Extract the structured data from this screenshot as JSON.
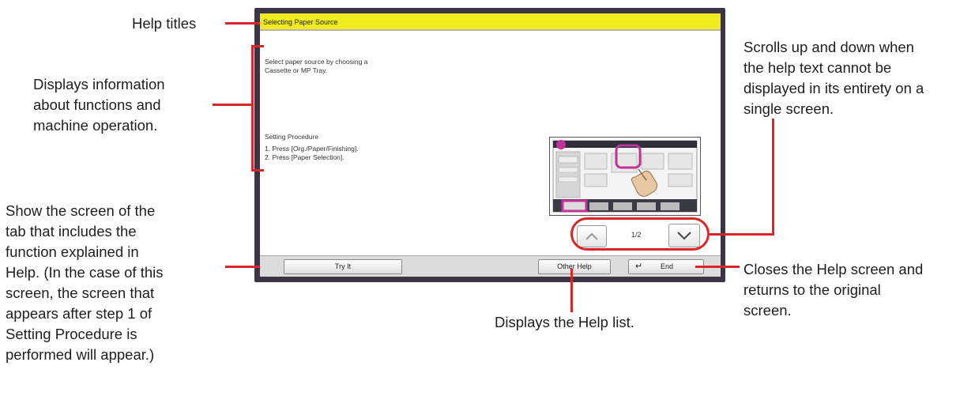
{
  "help_screen": {
    "title": "Selecting Paper Source",
    "description": [
      "Select paper source by choosing a",
      "Cassette or MP Tray."
    ],
    "procedure_heading": "Setting Procedure",
    "steps": [
      "1. Press [Org./Paper/Finishing].",
      "2. Press [Paper Selection]."
    ],
    "page_indicator": "1/2",
    "buttons": {
      "try_it": "Try It",
      "other_help": "Other Help",
      "end": "End"
    }
  },
  "callouts": {
    "help_titles": "Help titles",
    "info": [
      "Displays information",
      "about functions and",
      "machine operation."
    ],
    "scroll": [
      "Scrolls up and down when",
      "the help text cannot be",
      "displayed in its entirety on a",
      "single screen."
    ],
    "try_it": [
      "Show the screen of the",
      "tab that includes the",
      "function explained in",
      "Help. (In the case of this",
      "screen, the screen that",
      "appears after step 1 of",
      "Setting Procedure is",
      "performed will appear.)"
    ],
    "end": [
      "Closes the Help screen and",
      "returns to the original",
      "screen."
    ],
    "help_list": "Displays the Help list."
  },
  "colors": {
    "title_bar": "#f1ea1c",
    "callout_line": "#dc2626",
    "highlight_ring": "#c2329b",
    "panel_frame": "#3c3447"
  }
}
